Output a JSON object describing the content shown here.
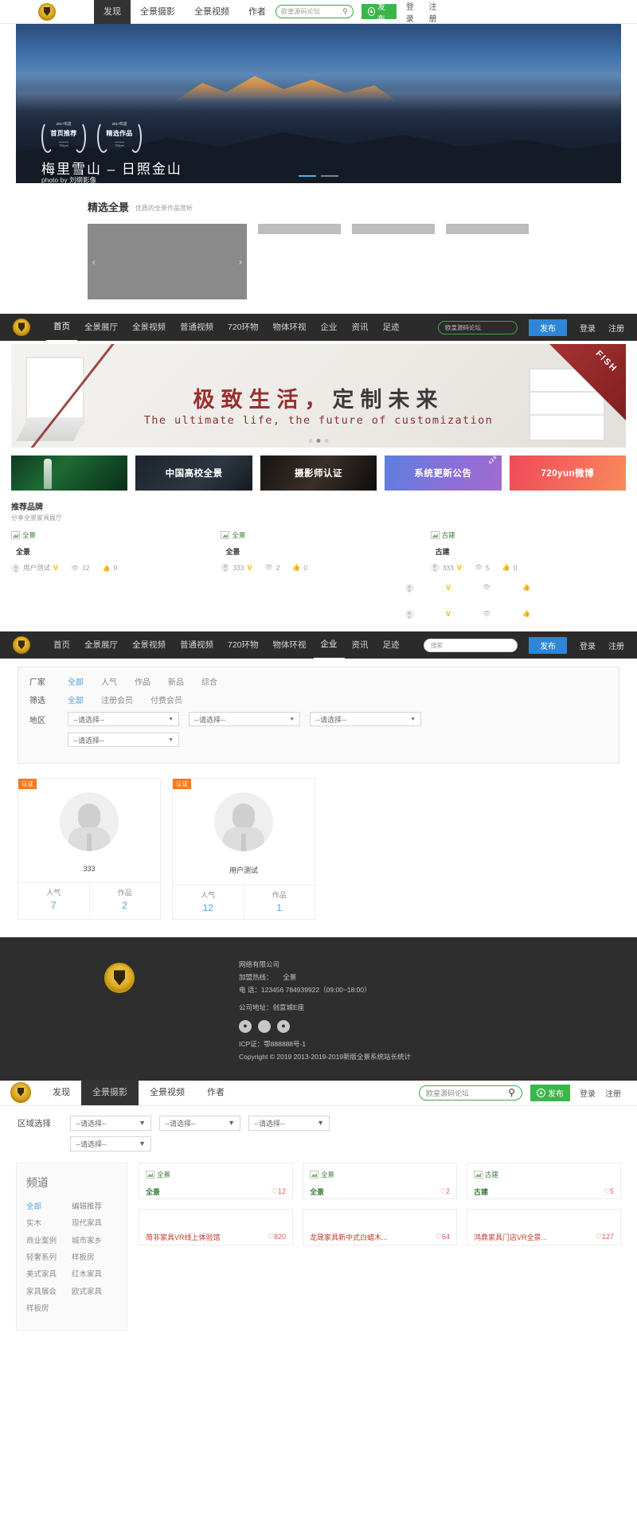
{
  "section1": {
    "nav": {
      "tabs": [
        "发现",
        "全景摄影",
        "全景视频",
        "作者"
      ],
      "active_index": 0
    },
    "search": {
      "placeholder": "欧皇源码论坛",
      "icon": "search-icon"
    },
    "publish_label": "发布",
    "login_label": "登录",
    "register_label": "注册",
    "hero": {
      "medals": [
        {
          "year": "2017年度",
          "main": "首页推荐",
          "sub": "720yun"
        },
        {
          "year": "2017年度",
          "main": "精选作品",
          "sub": "720yun"
        }
      ],
      "title": "梅里雪山 – 日照金山",
      "subtitle": "photo by 刘纲影像"
    },
    "featured": {
      "title": "精选全景",
      "subtitle": "优质的全景作品赏析"
    }
  },
  "section2": {
    "nav": {
      "items": [
        "首页",
        "全景展厅",
        "全景视频",
        "普通视频",
        "720环物",
        "物体环视",
        "企业",
        "资讯",
        "足迹"
      ],
      "active_index": 0
    },
    "search_placeholder": "欧皇源码论坛",
    "publish_label": "发布",
    "login_label": "登录",
    "register_label": "注册",
    "banner": {
      "title_red": "极致生活，",
      "title_dark": "定制未来",
      "subtitle": "The ultimate life, the future of customization",
      "corner_text": "FISH"
    },
    "tiles": [
      {
        "label": "",
        "tag": ""
      },
      {
        "label": "中国高校全景",
        "tag": ""
      },
      {
        "label": "摄影师认证",
        "tag": ""
      },
      {
        "label": "系统更新公告",
        "tag": "420"
      },
      {
        "label": "720yun微博",
        "tag": ""
      }
    ],
    "brands": {
      "title": "推荐品牌",
      "subtitle": "分享全景家具展厅",
      "items": [
        {
          "alt": "全景",
          "name": "全景",
          "author": "用户测试",
          "views": "12",
          "likes": "0"
        },
        {
          "alt": "全景",
          "name": "全景",
          "author": "333",
          "views": "2",
          "likes": "0"
        },
        {
          "alt": "古建",
          "name": "古建",
          "author": "333",
          "views": "5",
          "likes": "0"
        }
      ]
    }
  },
  "section3": {
    "nav": {
      "items": [
        "首页",
        "全景展厅",
        "全景视频",
        "普通视频",
        "720环物",
        "物体环视",
        "企业",
        "资讯",
        "足迹"
      ],
      "active_index": 6
    },
    "search_placeholder": "搜索",
    "publish_label": "发布",
    "login_label": "登录",
    "register_label": "注册",
    "filters": {
      "row1": {
        "label": "厂家",
        "options": [
          "全部",
          "人气",
          "作品",
          "新品",
          "综合"
        ],
        "active_index": 0
      },
      "row2": {
        "label": "筛选",
        "options": [
          "全部",
          "注册会员",
          "付费会员"
        ],
        "active_index": 0
      },
      "row3": {
        "label": "地区",
        "selects": [
          "--请选择--",
          "--请选择--",
          "--请选择--"
        ]
      },
      "row4": {
        "selects": [
          "--请选择--"
        ]
      }
    },
    "cards": [
      {
        "badge": "认证",
        "name": "333",
        "stats": [
          {
            "label": "人气",
            "value": "7"
          },
          {
            "label": "作品",
            "value": "2"
          }
        ]
      },
      {
        "badge": "认证",
        "name": "用户测试",
        "stats": [
          {
            "label": "人气",
            "value": "12"
          },
          {
            "label": "作品",
            "value": "1"
          }
        ]
      }
    ]
  },
  "footer": {
    "company": "网络有限公司",
    "hotline": "加盟热线：　　全景",
    "phone": "电 话：123456 784939922（09:00~18:00）",
    "address": "公司地址：创意城E座",
    "socials": [
      "wechat-icon",
      "weibo-icon",
      "qq-icon"
    ],
    "icp": "ICP证：鄂888888号-1",
    "copyright": "Copyright © 2019 2013-2019-2019新版全景系统站长统计"
  },
  "section4": {
    "nav": {
      "tabs": [
        "发现",
        "全景摄影",
        "全景视频",
        "作者"
      ],
      "active_index": 1
    },
    "search_placeholder": "欧皇源码论坛",
    "publish_label": "发布",
    "login_label": "登录",
    "register_label": "注册",
    "region": {
      "label": "区域选择",
      "selects_row1": [
        "--请选择--",
        "--请选择--",
        "--请选择--"
      ],
      "selects_row2": [
        "--请选择--"
      ]
    },
    "channels": {
      "title": "频道",
      "items": [
        "全部",
        "编辑推荐",
        "实木",
        "现代家具",
        "商业案例",
        "城市家乡",
        "轻奢系列",
        "样板房",
        "美式家具",
        "红木家具",
        "家具展会",
        "欧式家具",
        "样板房"
      ],
      "active_index": 0
    },
    "gallery": [
      {
        "alt": "全景",
        "name": "全景",
        "likes": "12",
        "broken": true
      },
      {
        "alt": "全景",
        "name": "全景",
        "likes": "2",
        "broken": true
      },
      {
        "alt": "古建",
        "name": "古建",
        "likes": "5",
        "broken": true
      },
      {
        "alt": "",
        "name": "简非家具VR线上体验馆",
        "likes": "820",
        "broken": false
      },
      {
        "alt": "",
        "name": "龙晟家具新中式白蜡木...",
        "likes": "64",
        "broken": false
      },
      {
        "alt": "",
        "name": "鸿鼎家具门店VR全景...",
        "likes": "127",
        "broken": false
      }
    ]
  }
}
